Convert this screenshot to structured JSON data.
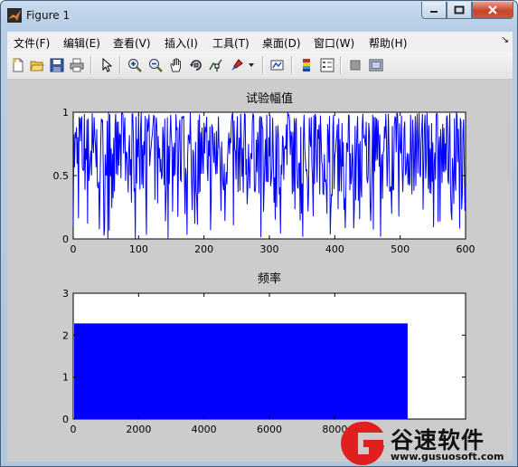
{
  "window": {
    "title": "Figure 1"
  },
  "menu": [
    "文件(F)",
    "编辑(E)",
    "查看(V)",
    "插入(I)",
    "工具(T)",
    "桌面(D)",
    "窗口(W)",
    "帮助(H)"
  ],
  "menu_extra": "↘",
  "toolbar": [
    "new-file-icon",
    "open-folder-icon",
    "save-icon",
    "print-icon",
    "pointer-icon",
    "zoom-in-icon",
    "zoom-out-icon",
    "pan-hand-icon",
    "rotate-3d-icon",
    "data-cursor-icon",
    "brush-icon",
    "brush-dropdown-icon",
    "link-plot-icon",
    "colorbar-icon",
    "legend-icon",
    "hide-tools-icon",
    "show-tools-icon"
  ],
  "watermark": {
    "name": "谷速软件",
    "url": "www.gusuosoft.com"
  },
  "chart_data": [
    {
      "type": "line",
      "title": "试验幅值",
      "xlabel": "",
      "ylabel": "",
      "xlim": [
        0,
        600
      ],
      "ylim": [
        0,
        1
      ],
      "xticks": [
        "0",
        "100",
        "200",
        "300",
        "400",
        "500",
        "600"
      ],
      "yticks": [
        "0",
        "0.5",
        "1"
      ],
      "series": [
        {
          "color": "#0000ff",
          "description": "dense noise-like signal spanning 0 to 1 over x = 0..600, mostly between about 0.35 and 1"
        }
      ],
      "grid": false
    },
    {
      "type": "bar",
      "title": "频率",
      "xlabel": "",
      "ylabel": "",
      "xlim": [
        0,
        12000
      ],
      "ylim": [
        0,
        3
      ],
      "xticks": [
        "0",
        "2000",
        "4000",
        "6000",
        "8000"
      ],
      "yticks": [
        "0",
        "1",
        "2",
        "3"
      ],
      "bar": {
        "x0": 0,
        "x1": 10200,
        "value": 2.28,
        "color": "#0000ff"
      },
      "grid": false
    }
  ]
}
